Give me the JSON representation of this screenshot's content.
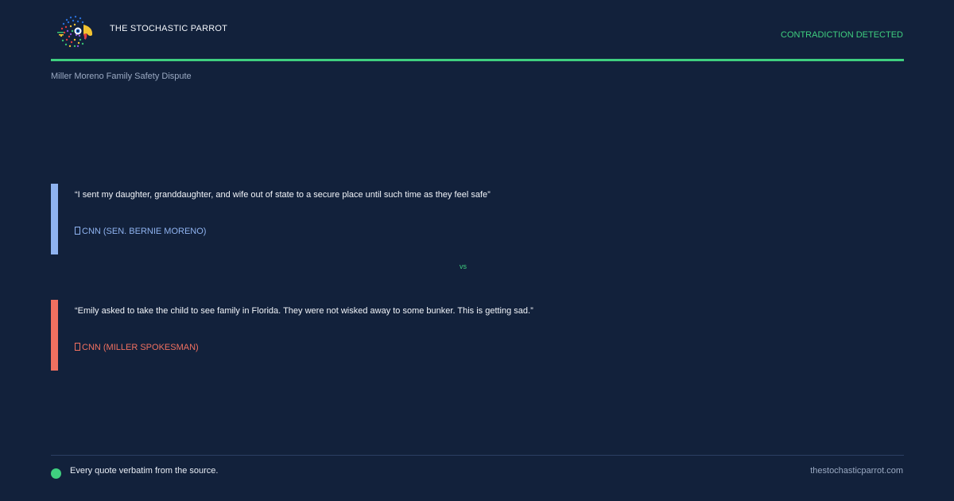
{
  "header": {
    "logo_icon": "parrot-logo-icon",
    "brand": "THE STOCHASTIC PARROT",
    "status": "CONTRADICTION DETECTED",
    "accent_color": "#3fcf7f"
  },
  "topic": "Miller Moreno Family Safety Dispute",
  "quotes": [
    {
      "text": "“I sent my daughter, granddaughter, and wife out of state to a secure place until such time as they feel safe”",
      "source": "CNN (SEN. BERNIE MORENO)",
      "source_icon": "document-icon",
      "color": "#8fb3f0"
    },
    {
      "text": "“Emily asked to take the child to see family in Florida. They were not wisked away to some bunker. This is getting sad.”",
      "source": "CNN (MILLER SPOKESMAN)",
      "source_icon": "document-icon",
      "color": "#f07060"
    }
  ],
  "separator": "vs",
  "footer": {
    "note": "Every quote verbatim from the source.",
    "site": "thestochasticparrot.com"
  }
}
